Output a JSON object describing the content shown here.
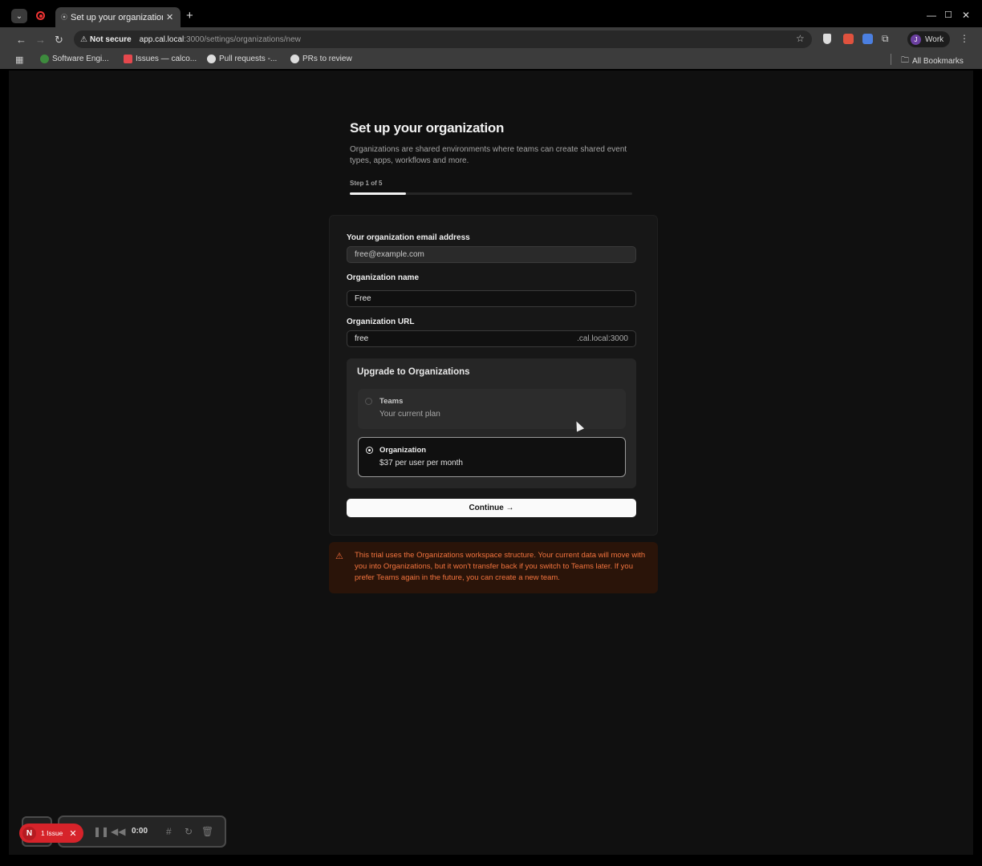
{
  "browser": {
    "tab_title": "Set up your organization",
    "tab_favicon": "⦿",
    "not_secure": "Not secure",
    "url_host": "app.cal.local",
    "url_path": ":3000/settings/organizations/new",
    "profile_initial": "J",
    "profile_name": "Work",
    "bookmarks": [
      {
        "label": "Software Engi...",
        "color": "#3d8b3d"
      },
      {
        "label": "Issues — calco...",
        "color": "#e5484d"
      },
      {
        "label": "Pull requests -...",
        "color": "#dddddd"
      },
      {
        "label": "PRs to review",
        "color": "#dddddd"
      }
    ],
    "all_bookmarks": "All Bookmarks"
  },
  "page": {
    "title": "Set up your organization",
    "subtitle": "Organizations are shared environments where teams can create shared event types, apps, workflows and more.",
    "step": "Step 1 of 5",
    "progress": 0.2,
    "form": {
      "email_label": "Your organization email address",
      "email_value": "free@example.com",
      "name_label": "Organization name",
      "name_value": "Free",
      "url_label": "Organization URL",
      "url_value": "free",
      "url_suffix": ".cal.local:3000"
    },
    "upgrade": {
      "title": "Upgrade to Organizations",
      "options": [
        {
          "name": "Teams",
          "desc": "Your current plan",
          "selected": false
        },
        {
          "name": "Organization",
          "desc": "$37 per user per month",
          "selected": true
        }
      ]
    },
    "continue_label": "Continue →",
    "alert": "This trial uses the Organizations workspace structure. Your current data will move with you into Organizations, but it won't transfer back if you switch to Teams later. If you prefer Teams again in the future, you can create a new team."
  },
  "recorder": {
    "issue_initial": "N",
    "issue_label": "1 Issue",
    "timer": "0:00"
  },
  "colors": {
    "accent_warning": "#f3743e",
    "background": "#101010",
    "issue_badge": "#d6232a"
  }
}
